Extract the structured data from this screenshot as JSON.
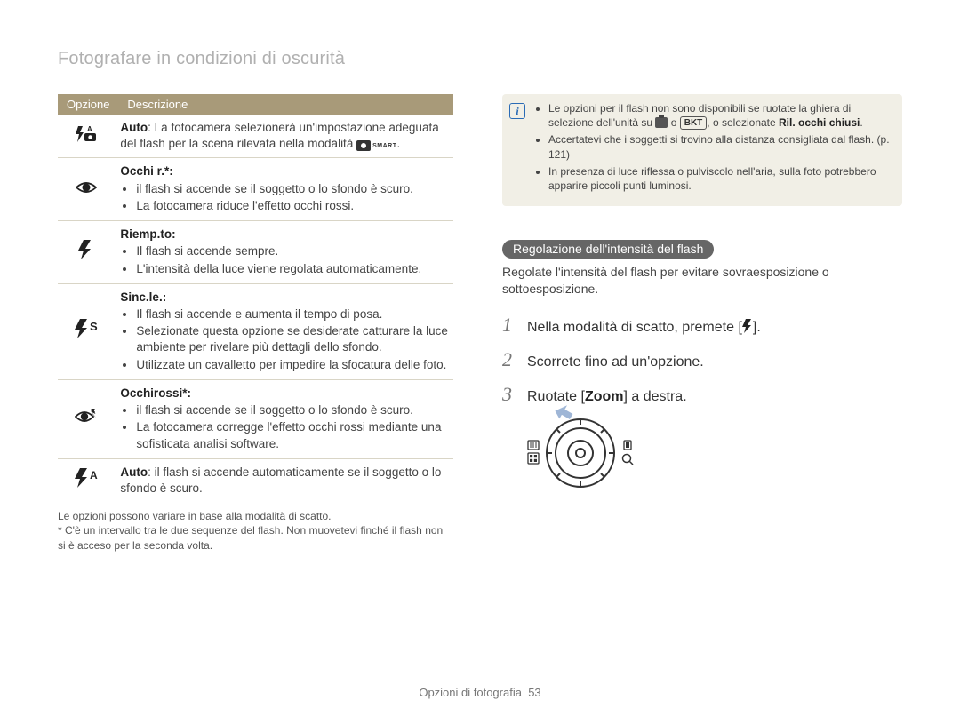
{
  "page": {
    "breadcrumb": "Fotografare in condizioni di oscurità",
    "footer_prefix": "Opzioni di fotografia",
    "footer_page": "53"
  },
  "table": {
    "col1": "Opzione",
    "col2": "Descrizione",
    "rows": {
      "auto": {
        "title": "Auto",
        "desc": ": La fotocamera selezionerà un'impostazione adeguata del flash per la scena rilevata nella modalità "
      },
      "occhi_r": {
        "title": "Occhi r.*:",
        "b1": "il flash si accende se il soggetto o lo sfondo è scuro.",
        "b2": "La fotocamera riduce l'effetto occhi rossi."
      },
      "riemp": {
        "title": "Riemp.to:",
        "b1": "Il flash si accende sempre.",
        "b2": "L'intensità della luce viene regolata automaticamente."
      },
      "sinc": {
        "title": "Sinc.le.:",
        "b1": "Il flash si accende e aumenta il tempo di posa.",
        "b2": "Selezionate questa opzione se desiderate catturare la luce ambiente per rivelare più dettagli dello sfondo.",
        "b3": "Utilizzate un cavalletto per impedire la sfocatura delle foto."
      },
      "occhirossi": {
        "title": "Occhirossi*:",
        "b1": "il flash si accende se il soggetto o lo sfondo è scuro.",
        "b2": "La fotocamera corregge l'effetto occhi rossi mediante una sofisticata analisi software."
      },
      "auto2": {
        "title": "Auto",
        "desc": ": il flash si accende automaticamente se il soggetto o lo sfondo è scuro."
      }
    },
    "foot1": "Le opzioni possono variare in base alla modalità di scatto.",
    "foot2": "* C'è un intervallo tra le due sequenze del flash. Non muovetevi finché il flash non si è acceso per la seconda volta."
  },
  "notebox": {
    "b1_pre": "Le opzioni per il flash non sono disponibili se ruotate la ghiera di selezione dell'unità su ",
    "b1_mid": " o ",
    "bkt": "BKT",
    "b1_post": ", o selezionate ",
    "b1_bold": "Ril. occhi chiusi",
    "b1_end": ".",
    "b2": "Accertatevi che i soggetti si trovino alla distanza consigliata dal flash. (p. 121)",
    "b3": "In presenza di luce riflessa o pulviscolo nell'aria, sulla foto potrebbero apparire piccoli punti luminosi."
  },
  "section": {
    "heading": "Regolazione dell'intensità del flash",
    "intro": "Regolate l'intensità del flash per evitare sovraesposizione o sottoesposizione.",
    "steps": {
      "s1_pre": "Nella modalità di scatto, premete [",
      "s1_post": "].",
      "s2": "Scorrete fino ad un'opzione.",
      "s3_pre": "Ruotate [",
      "s3_zoom": "Zoom",
      "s3_post": "] a destra."
    }
  },
  "icons": {
    "smart": "SMART"
  }
}
